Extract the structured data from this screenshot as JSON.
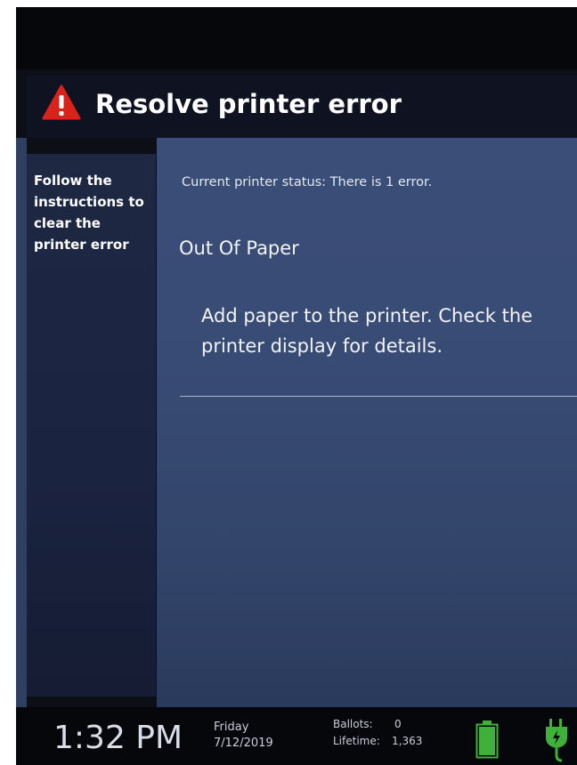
{
  "header": {
    "title": "Resolve printer error",
    "icon": "warning-triangle-icon",
    "icon_color": "#d9221a"
  },
  "sidebar": {
    "instructions": "Follow the instructions to clear the printer error"
  },
  "main": {
    "status_text": "Current printer status:  There is 1 error.",
    "error_title": "Out Of Paper",
    "error_instructions": "Add paper to the printer. Check the printer display for details."
  },
  "footer": {
    "time": "1:32 PM",
    "day": "Friday",
    "date": "7/12/2019",
    "ballots_label": "Ballots:",
    "ballots_value": "0",
    "lifetime_label": "Lifetime:",
    "lifetime_value": "1,363",
    "battery_icon": "battery-full-icon",
    "power_icon": "power-plug-icon",
    "status_color": "#3fb13a"
  }
}
